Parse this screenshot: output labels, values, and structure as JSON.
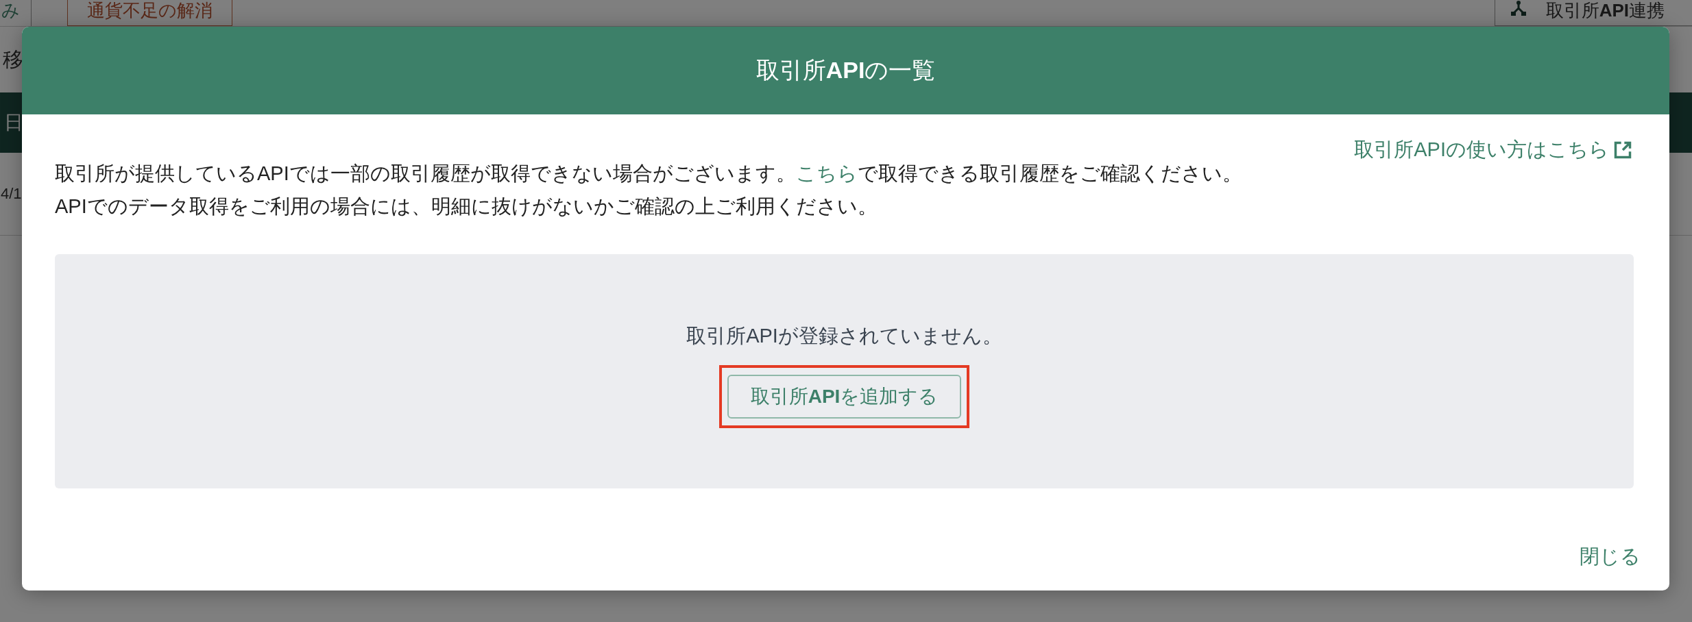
{
  "background": {
    "toolbar": [
      {
        "label": "み",
        "kind": "plain"
      },
      {
        "label": "通貨不足の解消",
        "kind": "warning"
      },
      {
        "label": "取引所**API**連携",
        "kind": "api"
      }
    ],
    "filter_text": "移",
    "table_header": "日",
    "row_date": "4/1"
  },
  "modal": {
    "title": "取引所**API**の一覧",
    "help_link": "取引所APIの使い方はこちら",
    "notice_line1": {
      "before": "取引所が提供しているAPIでは一部の取引履歴が取得できない場合がございます。",
      "link": "こちら",
      "after": "で取得できる取引履歴をご確認ください。"
    },
    "notice_line2": "APIでのデータ取得をご利用の場合には、明細に抜けがないかご確認の上ご利用ください。",
    "empty_message": "取引所APIが登録されていません。",
    "add_button": {
      "label": "取引所**API**を追加する",
      "highlighted": true
    },
    "close_button": "閉じる"
  }
}
